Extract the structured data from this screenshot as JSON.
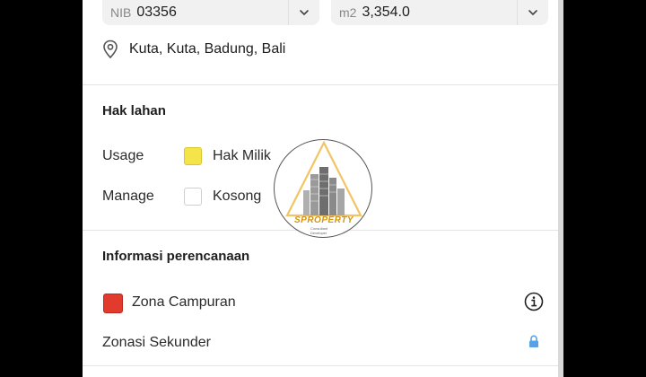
{
  "fields": {
    "nib": {
      "prefix": "NIB",
      "value": "03356"
    },
    "area": {
      "prefix": "m2",
      "value": "3,354.0"
    }
  },
  "location": {
    "text": "Kuta, Kuta, Badung, Bali",
    "icon": "location-pin-icon"
  },
  "hak_lahan": {
    "title": "Hak lahan",
    "usage": {
      "label": "Usage",
      "value": "Hak Milik",
      "color": "#f5e34a"
    },
    "manage": {
      "label": "Manage",
      "value": "Kosong",
      "color": "#ffffff"
    }
  },
  "watermark": {
    "text": "SPROPERTY",
    "sub_1": "Consultant",
    "sub_2": "Developer"
  },
  "perencanaan": {
    "title": "Informasi perencanaan",
    "zona": {
      "value": "Zona Campuran",
      "color": "#e23a2c",
      "icon": "info-icon"
    },
    "zonasi": {
      "label": "Zonasi Sekunder",
      "icon": "lock-icon",
      "icon_color": "#5aa0e6"
    }
  }
}
